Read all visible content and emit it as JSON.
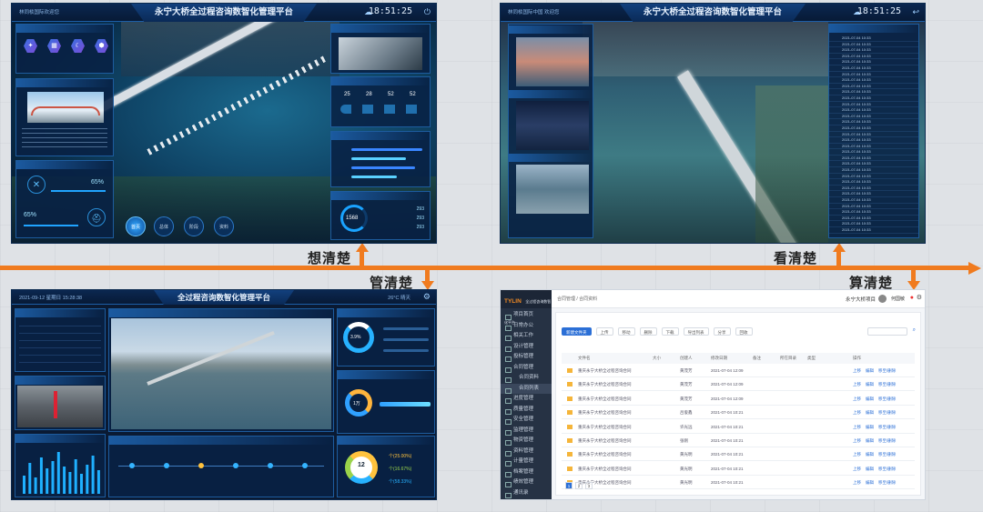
{
  "labels": {
    "think": "想清楚",
    "manage": "管清楚",
    "see": "看清楚",
    "calc": "算清楚"
  },
  "screen1": {
    "title": "永宁大桥全过程咨询数智化管理平台",
    "left_text": "林同棪国际欢迎您",
    "clock": "18:51:25",
    "progress_a": "65%",
    "progress_b": "65%",
    "count": "1568",
    "values": [
      "293",
      "293",
      "293"
    ],
    "stat_nums": [
      "25",
      "28",
      "52",
      "52"
    ],
    "nav_buttons": [
      "首页",
      "总体",
      "阶段",
      "资料"
    ]
  },
  "screen2": {
    "title": "永宁大桥全过程咨询数智化管理平台",
    "left_text": "林同棪国际中国 欢迎您",
    "clock": "18:51:25",
    "list_dates": [
      "2021-07-04 10:33",
      "2021-07-04 10:33",
      "2021-07-04 10:33",
      "2021-07-04 10:33",
      "2021-07-04 10:33",
      "2021-07-04 10:33",
      "2021-07-04 10:33",
      "2021-07-04 10:33",
      "2021-07-04 10:33",
      "2021-07-04 10:33",
      "2021-07-04 10:33",
      "2021-07-04 10:33",
      "2021-07-04 10:33",
      "2021-07-04 10:33",
      "2021-07-04 10:33",
      "2021-07-04 10:33",
      "2021-07-04 10:33",
      "2021-07-04 10:33",
      "2021-07-04 10:33",
      "2021-07-04 10:33",
      "2021-07-04 10:33",
      "2021-07-04 10:33",
      "2021-07-04 10:33",
      "2021-07-04 10:33",
      "2021-07-04 10:33",
      "2021-07-04 10:33",
      "2021-07-04 10:33",
      "2021-07-04 10:33",
      "2021-07-04 10:33",
      "2021-07-04 10:33",
      "2021-07-04 10:33",
      "2021-07-04 10:33",
      "2021-07-04 10:33"
    ]
  },
  "screen3": {
    "title": "全过程咨询数智化管理平台",
    "date": "2021-09-12 星期日 15:28:38",
    "weather": "26°C 晴天",
    "center_num": "12",
    "legend": [
      "个(25.00%)",
      "个(16.67%)",
      "个(58.33%)"
    ],
    "donut_text": "3.9%",
    "big_num": "1万"
  },
  "screen4": {
    "brand": "TYLIN",
    "brand_name": "全过程咨询数智化平台",
    "breadcrumb": "合同管理 / 合同资料",
    "project": "永宁大桥项目",
    "user": "何国敏",
    "menu": [
      "项目首页",
      "日常办公",
      "相关工作",
      "设计管理",
      "投标管理",
      "合同管理",
      "合同资料",
      "合同列表",
      "进度管理",
      "质量管理",
      "安全管理",
      "监理管理",
      "物资管理",
      "资料管理",
      "计量管理",
      "档案管理",
      "绩效管理",
      "通讯录"
    ],
    "toolbar": [
      "新建文件夹",
      "上传",
      "移动",
      "删除",
      "下载",
      "导出列表",
      "分享",
      "回收"
    ],
    "columns": [
      "文件名",
      "大小",
      "创建人",
      "修改日期",
      "备注",
      "所在目录",
      "类型",
      "操作"
    ],
    "rows": [
      {
        "name": "重庆永宁大桥全过程咨询合同",
        "user": "黄茂芳",
        "date": "2021-07-04 12:09"
      },
      {
        "name": "重庆永宁大桥全过程咨询合同",
        "user": "黄茂芳",
        "date": "2021-07-04 12:09"
      },
      {
        "name": "重庆永宁大桥全过程咨询合同",
        "user": "黄茂芳",
        "date": "2021-07-04 12:09"
      },
      {
        "name": "重庆永宁大桥全过程咨询合同",
        "user": "吕俊鑫",
        "date": "2021-07-04 10:21"
      },
      {
        "name": "重庆永宁大桥全过程咨询合同",
        "user": "许光远",
        "date": "2021-07-04 10:21"
      },
      {
        "name": "重庆永宁大桥全过程咨询合同",
        "user": "张刚",
        "date": "2021-07-04 10:21"
      },
      {
        "name": "重庆永宁大桥全过程咨询合同",
        "user": "黄光明",
        "date": "2021-07-04 10:21"
      },
      {
        "name": "重庆永宁大桥全过程咨询合同",
        "user": "黄光明",
        "date": "2021-07-04 10:21"
      },
      {
        "name": "重庆永宁大桥全过程咨询合同",
        "user": "黄光明",
        "date": "2021-07-04 10:21"
      }
    ],
    "row_actions": [
      "上移",
      "编辑",
      "移至/删除"
    ],
    "pager": [
      "1",
      "2",
      "3"
    ]
  }
}
